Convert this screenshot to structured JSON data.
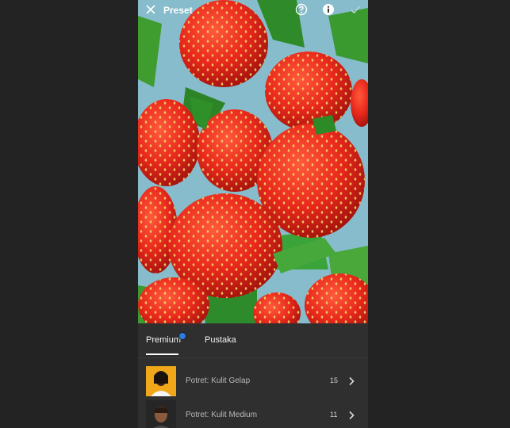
{
  "header": {
    "title": "Preset",
    "close_icon": "close-icon",
    "help_icon": "help-circle-icon",
    "info_icon": "info-circle-icon",
    "confirm_icon": "checkmark-icon"
  },
  "tabs": [
    {
      "label": "Premium",
      "active": true,
      "badge": "premium-star-badge"
    },
    {
      "label": "Pustaka",
      "active": false
    }
  ],
  "presets": [
    {
      "label": "Potret: Kulit Gelap",
      "count": "15"
    },
    {
      "label": "Potret: Kulit Medium",
      "count": "11"
    }
  ],
  "colors": {
    "background": "#232323",
    "panel": "#2f2f2f",
    "accent_badge": "#2a7ee6",
    "strawberry": "#e8281c"
  }
}
